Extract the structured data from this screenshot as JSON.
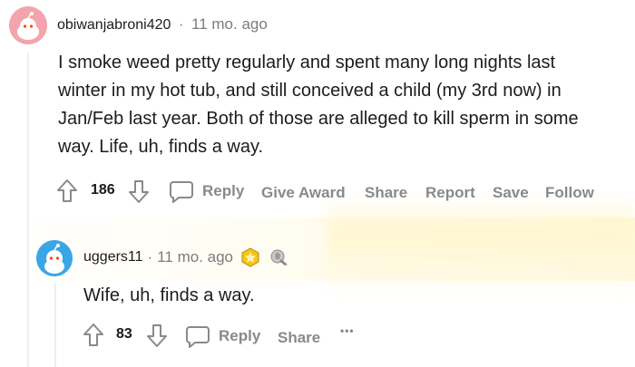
{
  "comment1": {
    "username": "obiwanjabroni420",
    "separator": "·",
    "time": "11 mo. ago",
    "body_lines": [
      "I smoke weed pretty regularly and spent many long nights last",
      "winter in my hot tub, and still conceived a child (my 3rd now) in",
      "Jan/Feb last year. Both of those are alleged to kill sperm in some",
      "way. Life, uh, finds a way."
    ],
    "votes": "186",
    "actions": {
      "reply": "Reply",
      "give_award": "Give Award",
      "share": "Share",
      "report": "Report",
      "save": "Save",
      "follow": "Follow"
    }
  },
  "comment2": {
    "username": "uggers11",
    "separator": "·",
    "time": "11 mo. ago",
    "body": "Wife, uh, finds a way.",
    "votes": "83",
    "actions": {
      "reply": "Reply",
      "share": "Share",
      "more": "•••"
    }
  },
  "icons": {
    "upvote": "upvote-arrow-icon",
    "downvote": "downvote-arrow-icon",
    "reply": "speech-bubble-icon",
    "award1": "gold-award-icon",
    "award2": "silver-award-icon"
  },
  "colors": {
    "avatar1": "#f4a4ac",
    "avatar2": "#3ba6e6",
    "meta_gray": "#7c7c7c",
    "action_gray": "#878a8c"
  }
}
